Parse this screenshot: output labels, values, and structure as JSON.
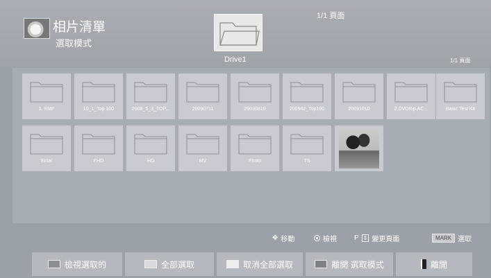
{
  "header": {
    "title": "相片清單",
    "subtitle": "選取模式",
    "drive_label": "Drive1",
    "page_top": "1/1 頁面",
    "page_right": "1/1 頁面"
  },
  "grid": {
    "row1": [
      "1. EMF",
      "10_1_Top 100",
      "2008_5_3_TOP...",
      "20090711",
      "20090810",
      "200942_Top100",
      "20091010",
      "2.DVDRip.AC...",
      "Basic Test Kit"
    ],
    "row2": [
      "Ental",
      "FHD",
      "HD",
      "MV",
      "Photo",
      "TS"
    ]
  },
  "legend": {
    "move": "移動",
    "view": "檢視",
    "page_prefix": "P",
    "change_page": "變更頁面",
    "mark_key": "MARK",
    "select": "選取"
  },
  "buttons": {
    "view_selected": "檢視選取的",
    "select_all": "全部選取",
    "deselect_all": "取消全部選取",
    "exit_select_mode": "離開 選取模式",
    "exit": "離開"
  },
  "colors": {
    "red": "#8a8f94",
    "green": "#d8dadc",
    "yellow": "#eeeeee",
    "blue": "#7c8188"
  }
}
